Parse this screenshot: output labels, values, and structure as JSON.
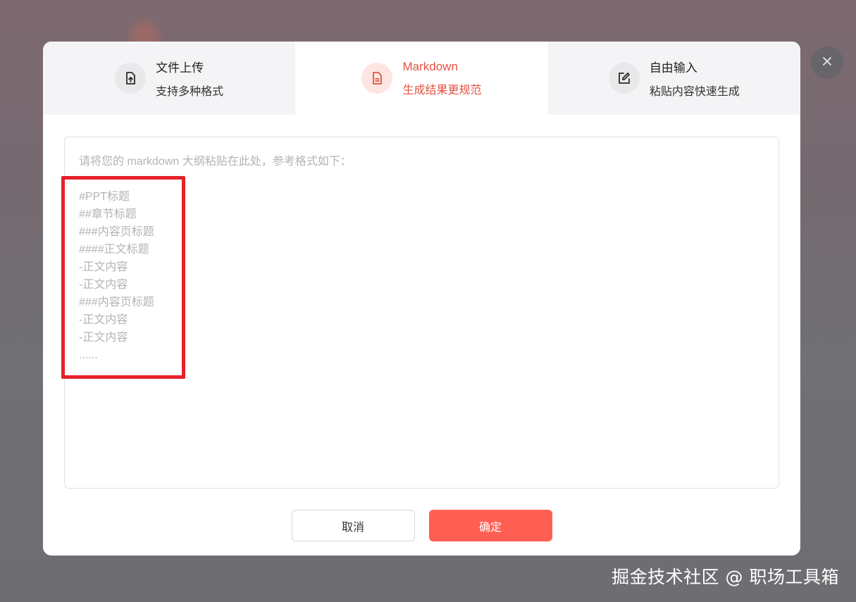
{
  "tabs": [
    {
      "title": "文件上传",
      "subtitle": "支持多种格式",
      "icon": "file-upload-icon",
      "active": false
    },
    {
      "title": "Markdown",
      "subtitle": "生成结果更规范",
      "icon": "document-icon",
      "active": true
    },
    {
      "title": "自由输入",
      "subtitle": "粘贴内容快速生成",
      "icon": "edit-icon",
      "active": false
    }
  ],
  "editor": {
    "placeholder_intro": "请将您的 markdown 大纲粘贴在此处，参考格式如下：",
    "placeholder_lines": [
      "#PPT标题",
      "##章节标题",
      "###内容页标题",
      "####正文标题",
      "-正文内容",
      "-正文内容",
      "###内容页标题",
      "-正文内容",
      "-正文内容",
      "......"
    ]
  },
  "buttons": {
    "cancel_label": "取消",
    "confirm_label": "确定"
  },
  "watermark": "掘金技术社区 @ 职场工具箱",
  "colors": {
    "accent": "#e4513f",
    "confirm_button": "#ff5f52",
    "highlight_box": "#e5212a"
  }
}
